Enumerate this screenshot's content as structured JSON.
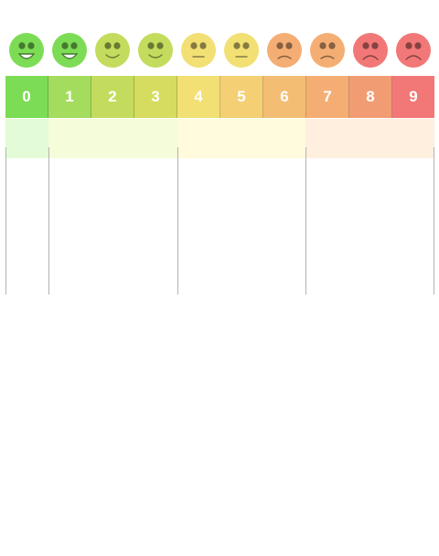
{
  "scale": {
    "levels": [
      {
        "label": "0",
        "color": "#7ddc55",
        "face": "happy-face-icon"
      },
      {
        "label": "1",
        "color": "#a4dc5d",
        "face": "happy-face-icon"
      },
      {
        "label": "2",
        "color": "#c3dc5d",
        "face": "slight-smile-face-icon"
      },
      {
        "label": "3",
        "color": "#d6dc5f",
        "face": "slight-smile-face-icon"
      },
      {
        "label": "4",
        "color": "#f2e074",
        "face": "neutral-face-icon"
      },
      {
        "label": "5",
        "color": "#f4cf74",
        "face": "neutral-face-icon"
      },
      {
        "label": "6",
        "color": "#f4bd74",
        "face": "slight-frown-face-icon"
      },
      {
        "label": "7",
        "color": "#f4ae74",
        "face": "slight-frown-face-icon"
      },
      {
        "label": "8",
        "color": "#f29c74",
        "face": "sad-face-icon"
      },
      {
        "label": "9",
        "color": "#f27877",
        "face": "sad-face-icon"
      }
    ],
    "face_colors": [
      "#7ddc55",
      "#7ddc55",
      "#c3dc5d",
      "#c3dc5d",
      "#f2e074",
      "#f2e074",
      "#f4ae74",
      "#f4ae74",
      "#f27877",
      "#f27877"
    ],
    "bands": [
      {
        "from": 0,
        "to": 0,
        "color": "#e3fbd6"
      },
      {
        "from": 1,
        "to": 3,
        "color": "#f5fcd9"
      },
      {
        "from": 4,
        "to": 6,
        "color": "#fffbdc"
      },
      {
        "from": 7,
        "to": 9,
        "color": "#ffefdf"
      }
    ]
  }
}
